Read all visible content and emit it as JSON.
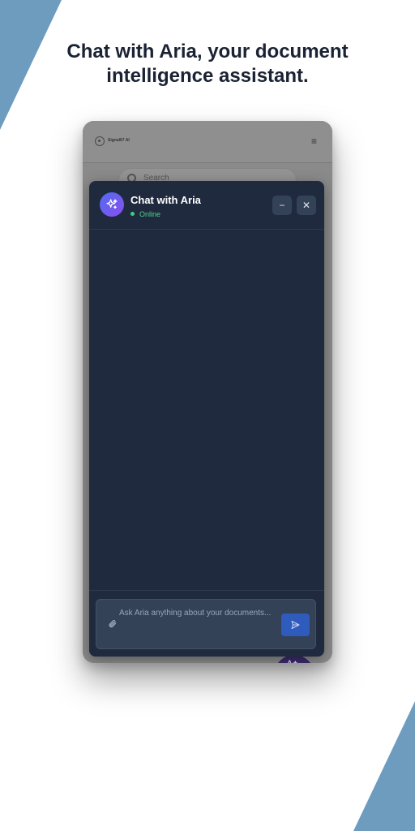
{
  "headline": {
    "line1": "Chat with Aria, your document",
    "line2": "intelligence assistant."
  },
  "background_app": {
    "brand": "Signal67 AI",
    "search_placeholder": "Search"
  },
  "chat": {
    "title": "Chat with Aria",
    "status": "Online",
    "input_placeholder": "Ask Aria anything about your documents...",
    "minimize_symbol": "−",
    "close_symbol": "✕"
  },
  "colors": {
    "accent_bar": "#6e9cbf",
    "panel_bg": "#1f2a3e",
    "status_green": "#3ecf7a",
    "send_button": "#2f5bbd",
    "avatar_gradient_start": "#4f6df0",
    "avatar_gradient_end": "#8a4ef0"
  },
  "icons": {
    "avatar": "sparkle-icon",
    "attach": "paperclip-icon",
    "send": "paper-plane-icon",
    "menu": "hamburger-menu-icon",
    "search": "search-icon"
  }
}
